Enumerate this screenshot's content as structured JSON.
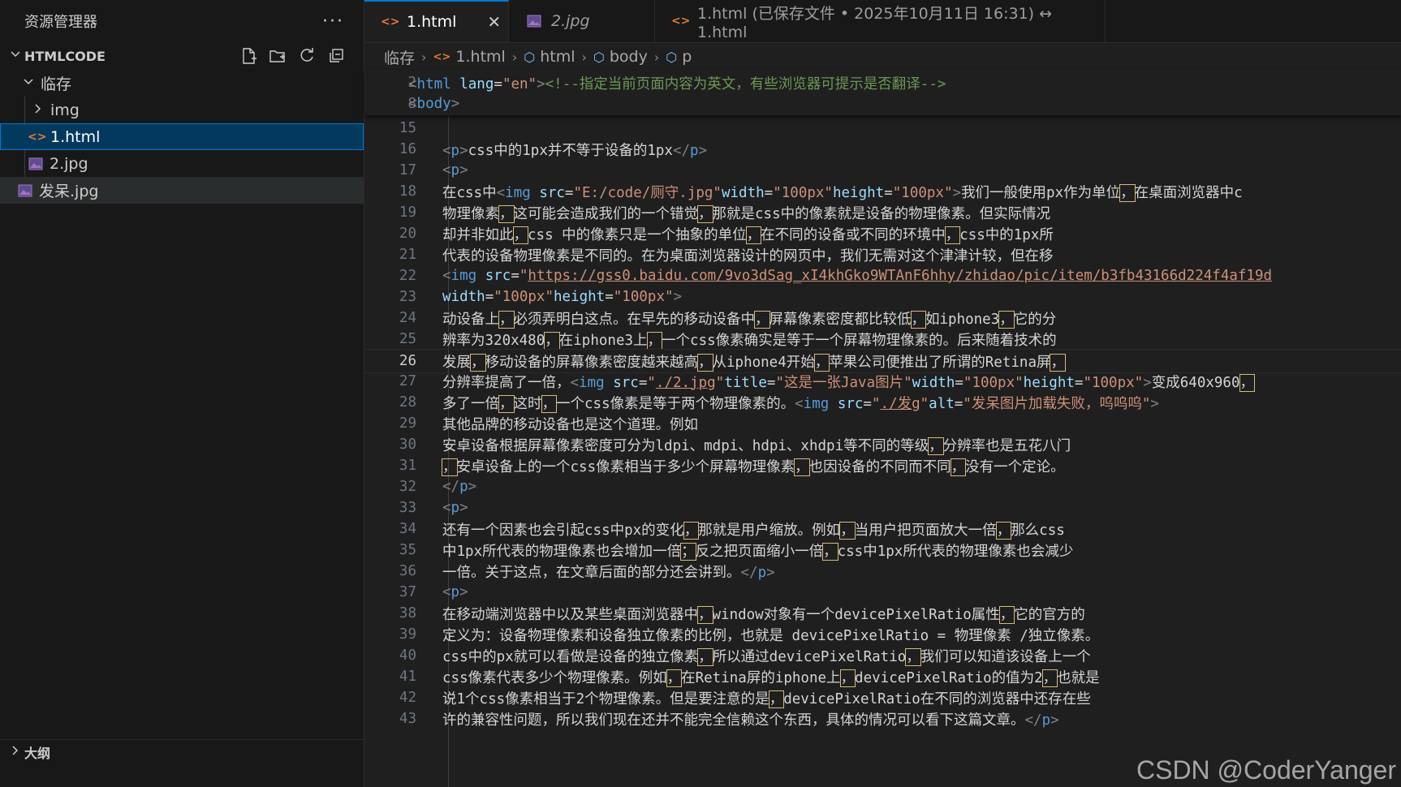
{
  "sidebar": {
    "title": "资源管理器",
    "more": "···",
    "section": "HTMLCODE",
    "tree": [
      {
        "label": "临存",
        "kind": "folder-open",
        "level": 1
      },
      {
        "label": "img",
        "kind": "folder",
        "level": 2
      },
      {
        "label": "1.html",
        "kind": "html",
        "level": 2,
        "selected": true
      },
      {
        "label": "2.jpg",
        "kind": "image",
        "level": 2
      },
      {
        "label": "发呆.jpg",
        "kind": "image",
        "level": 1,
        "hover": true
      }
    ],
    "bottom_section": "大纲"
  },
  "tabs": [
    {
      "label": "1.html",
      "icon": "html-icon",
      "active": true,
      "close": "✕"
    },
    {
      "label": "2.jpg",
      "icon": "image-icon",
      "italic": true
    },
    {
      "label": "1.html (已保存文件 • 2025年10月11日 16:31) ↔ 1.html",
      "icon": "html-icon"
    }
  ],
  "breadcrumb": [
    "临存",
    "1.html",
    "html",
    "body",
    "p"
  ],
  "editor": {
    "current_line": 26,
    "sticky_lines": [
      {
        "n": 2,
        "segs": [
          [
            "t",
            "<"
          ],
          [
            "n",
            "html "
          ],
          [
            "a",
            "lang"
          ],
          [
            "x",
            "="
          ],
          [
            "s",
            "\"en\""
          ],
          [
            "t",
            ">"
          ],
          [
            "c",
            "<!--指定当前页面内容为英文，有些浏览器可提示是否翻译-->"
          ]
        ]
      },
      {
        "n": 8,
        "segs": [
          [
            "t",
            "<"
          ],
          [
            "n",
            "body"
          ],
          [
            "t",
            ">"
          ]
        ]
      }
    ],
    "lines": [
      {
        "n": 15,
        "segs": []
      },
      {
        "n": 16,
        "segs": [
          [
            "t",
            "<"
          ],
          [
            "n",
            "p"
          ],
          [
            "t",
            ">"
          ],
          [
            "x",
            "css中的1px并不等于设备的1px"
          ],
          [
            "t",
            "</"
          ],
          [
            "n",
            "p"
          ],
          [
            "t",
            ">"
          ]
        ]
      },
      {
        "n": 17,
        "segs": [
          [
            "t",
            "<"
          ],
          [
            "n",
            "p"
          ],
          [
            "t",
            ">"
          ]
        ]
      },
      {
        "n": 18,
        "segs": [
          [
            "x",
            "在css中"
          ],
          [
            "t",
            "<"
          ],
          [
            "n",
            "img "
          ],
          [
            "a",
            "src"
          ],
          [
            "x",
            "="
          ],
          [
            "s",
            "\"E:/code/厕守.jpg\""
          ],
          [
            "a",
            "width"
          ],
          [
            "x",
            "="
          ],
          [
            "s",
            "\"100px\""
          ],
          [
            "a",
            "height"
          ],
          [
            "x",
            "="
          ],
          [
            "s",
            "\"100px\""
          ],
          [
            "t",
            ">"
          ],
          [
            "x",
            "我们一般使用px作为单位"
          ],
          [
            "b",
            "，"
          ],
          [
            "x",
            "在桌面浏览器中c"
          ]
        ]
      },
      {
        "n": 19,
        "segs": [
          [
            "x",
            "物理像素"
          ],
          [
            "b",
            "，"
          ],
          [
            "x",
            "这可能会造成我们的一个错觉"
          ],
          [
            "b",
            "，"
          ],
          [
            "x",
            "那就是css中的像素就是设备的物理像素。但实际情况"
          ]
        ]
      },
      {
        "n": 20,
        "segs": [
          [
            "x",
            "却并非如此"
          ],
          [
            "b",
            "，"
          ],
          [
            "x",
            "css 中的像素只是一个抽象的单位"
          ],
          [
            "b",
            "，"
          ],
          [
            "x",
            "在不同的设备或不同的环境中"
          ],
          [
            "b",
            "，"
          ],
          [
            "x",
            "css中的1px所"
          ]
        ]
      },
      {
        "n": 21,
        "segs": [
          [
            "x",
            "代表的设备物理像素是不同的。在为桌面浏览器设计的网页中，我们无需对这个津津计较，但在移"
          ]
        ]
      },
      {
        "n": 22,
        "segs": [
          [
            "t",
            "<"
          ],
          [
            "n",
            "img "
          ],
          [
            "a",
            "src"
          ],
          [
            "x",
            "="
          ],
          [
            "s",
            "\""
          ],
          [
            "l",
            "https://gss0.baidu.com/9vo3dSag_xI4khGko9WTAnF6hhy/zhidao/pic/item/b3fb43166d224f4af19d"
          ]
        ]
      },
      {
        "n": 23,
        "segs": [
          [
            "a",
            "width"
          ],
          [
            "x",
            "="
          ],
          [
            "s",
            "\"100px\""
          ],
          [
            "a",
            "height"
          ],
          [
            "x",
            "="
          ],
          [
            "s",
            "\"100px\""
          ],
          [
            "t",
            ">"
          ]
        ]
      },
      {
        "n": 24,
        "segs": [
          [
            "x",
            "动设备上"
          ],
          [
            "b",
            "，"
          ],
          [
            "x",
            "必须弄明白这点。在早先的移动设备中"
          ],
          [
            "b",
            "，"
          ],
          [
            "x",
            "屏幕像素密度都比较低"
          ],
          [
            "b",
            "，"
          ],
          [
            "x",
            "如iphone3"
          ],
          [
            "b",
            "，"
          ],
          [
            "x",
            "它的分"
          ]
        ]
      },
      {
        "n": 25,
        "segs": [
          [
            "x",
            "辨率为320x480"
          ],
          [
            "b",
            "，"
          ],
          [
            "x",
            "在iphone3上"
          ],
          [
            "b",
            "，"
          ],
          [
            "x",
            "一个css像素确实是等于一个屏幕物理像素的。后来随着技术的"
          ]
        ]
      },
      {
        "n": 26,
        "segs": [
          [
            "x",
            "发展"
          ],
          [
            "b",
            "，"
          ],
          [
            "x",
            "移动设备的屏幕像素密度越来越高"
          ],
          [
            "b",
            "，"
          ],
          [
            "x",
            "从iphone4开始"
          ],
          [
            "b",
            "，"
          ],
          [
            "x",
            "苹果公司便推出了所谓的Retina屏"
          ],
          [
            "b",
            "，"
          ]
        ]
      },
      {
        "n": 27,
        "segs": [
          [
            "x",
            "分辨率提高了一倍，"
          ],
          [
            "t",
            "<"
          ],
          [
            "n",
            "img "
          ],
          [
            "a",
            "src"
          ],
          [
            "x",
            "="
          ],
          [
            "s",
            "\""
          ],
          [
            "l",
            "./2.jpg"
          ],
          [
            "s",
            "\""
          ],
          [
            "a",
            "title"
          ],
          [
            "x",
            "="
          ],
          [
            "s",
            "\"这是一张Java图片\""
          ],
          [
            "a",
            "width"
          ],
          [
            "x",
            "="
          ],
          [
            "s",
            "\"100px\""
          ],
          [
            "a",
            "height"
          ],
          [
            "x",
            "="
          ],
          [
            "s",
            "\"100px\""
          ],
          [
            "t",
            ">"
          ],
          [
            "x",
            "变成640x960"
          ],
          [
            "b",
            "，"
          ]
        ]
      },
      {
        "n": 28,
        "segs": [
          [
            "x",
            "多了一倍"
          ],
          [
            "b",
            "，"
          ],
          [
            "x",
            "这时"
          ],
          [
            "b",
            "，"
          ],
          [
            "x",
            "一个css像素是等于两个物理像素的。"
          ],
          [
            "t",
            "<"
          ],
          [
            "n",
            "img "
          ],
          [
            "a",
            "src"
          ],
          [
            "x",
            "="
          ],
          [
            "s",
            "\""
          ],
          [
            "l",
            "./发g"
          ],
          [
            "s",
            "\""
          ],
          [
            "a",
            "alt"
          ],
          [
            "x",
            "="
          ],
          [
            "s",
            "\"发呆图片加载失败，呜呜呜\""
          ],
          [
            "t",
            ">"
          ]
        ]
      },
      {
        "n": 29,
        "segs": [
          [
            "x",
            "其他品牌的移动设备也是这个道理。例如"
          ]
        ]
      },
      {
        "n": 30,
        "segs": [
          [
            "x",
            "安卓设备根据屏幕像素密度可分为ldpi、mdpi、hdpi、xhdpi等不同的等级"
          ],
          [
            "b",
            "，"
          ],
          [
            "x",
            "分辨率也是五花八门"
          ]
        ]
      },
      {
        "n": 31,
        "segs": [
          [
            "b",
            "，"
          ],
          [
            "x",
            "安卓设备上的一个css像素相当于多少个屏幕物理像素"
          ],
          [
            "b",
            "，"
          ],
          [
            "x",
            "也因设备的不同而不同"
          ],
          [
            "b",
            "，"
          ],
          [
            "x",
            "没有一个定论。"
          ]
        ]
      },
      {
        "n": 32,
        "segs": [
          [
            "t",
            "</"
          ],
          [
            "n",
            "p"
          ],
          [
            "t",
            ">"
          ]
        ]
      },
      {
        "n": 33,
        "segs": [
          [
            "t",
            "<"
          ],
          [
            "n",
            "p"
          ],
          [
            "t",
            ">"
          ]
        ]
      },
      {
        "n": 34,
        "segs": [
          [
            "x",
            "还有一个因素也会引起css中px的变化"
          ],
          [
            "b",
            "，"
          ],
          [
            "x",
            "那就是用户缩放。例如"
          ],
          [
            "b",
            "，"
          ],
          [
            "x",
            "当用户把页面放大一倍"
          ],
          [
            "b",
            "，"
          ],
          [
            "x",
            "那么css"
          ]
        ]
      },
      {
        "n": 35,
        "segs": [
          [
            "x",
            "中1px所代表的物理像素也会增加一倍"
          ],
          [
            "b",
            "；"
          ],
          [
            "x",
            "反之把页面缩小一倍"
          ],
          [
            "b",
            "，"
          ],
          [
            "x",
            "css中1px所代表的物理像素也会减少"
          ]
        ]
      },
      {
        "n": 36,
        "segs": [
          [
            "x",
            "一倍。关于这点，在文章后面的部分还会讲到。"
          ],
          [
            "t",
            "</"
          ],
          [
            "n",
            "p"
          ],
          [
            "t",
            ">"
          ]
        ]
      },
      {
        "n": 37,
        "segs": [
          [
            "t",
            "<"
          ],
          [
            "n",
            "p"
          ],
          [
            "t",
            ">"
          ]
        ]
      },
      {
        "n": 38,
        "segs": [
          [
            "x",
            "在移动端浏览器中以及某些桌面浏览器中"
          ],
          [
            "b",
            "，"
          ],
          [
            "x",
            "window对象有一个devicePixelRatio属性"
          ],
          [
            "b",
            "，"
          ],
          [
            "x",
            "它的官方的"
          ]
        ]
      },
      {
        "n": 39,
        "segs": [
          [
            "x",
            "定义为：设备物理像素和设备独立像素的比例，也就是 devicePixelRatio = 物理像素 /独立像素。"
          ]
        ]
      },
      {
        "n": 40,
        "segs": [
          [
            "x",
            "css中的px就可以看做是设备的独立像素"
          ],
          [
            "b",
            "，"
          ],
          [
            "x",
            "所以通过devicePixelRatio"
          ],
          [
            "b",
            "，"
          ],
          [
            "x",
            "我们可以知道该设备上一个"
          ]
        ]
      },
      {
        "n": 41,
        "segs": [
          [
            "x",
            "css像素代表多少个物理像素。例如"
          ],
          [
            "b",
            "，"
          ],
          [
            "x",
            "在Retina屏的iphone上"
          ],
          [
            "b",
            "，"
          ],
          [
            "x",
            "devicePixelRatio的值为2"
          ],
          [
            "b",
            "，"
          ],
          [
            "x",
            "也就是"
          ]
        ]
      },
      {
        "n": 42,
        "segs": [
          [
            "x",
            "说1个css像素相当于2个物理像素。但是要注意的是"
          ],
          [
            "b",
            "，"
          ],
          [
            "x",
            "devicePixelRatio在不同的浏览器中还存在些"
          ]
        ]
      },
      {
        "n": 43,
        "segs": [
          [
            "x",
            "许的兼容性问题，所以我们现在还并不能完全信赖这个东西，具体的情况可以看下这篇文章。"
          ],
          [
            "t",
            "</"
          ],
          [
            "n",
            "p"
          ],
          [
            "t",
            ">"
          ]
        ]
      }
    ]
  },
  "watermark": "CSDN @CoderYanger",
  "colors": {
    "accent": "#0078d4",
    "tag": "#569cd6",
    "attr": "#9cdcfe",
    "string": "#ce9178",
    "comment": "#6a9955",
    "html_icon": "#e37933"
  }
}
